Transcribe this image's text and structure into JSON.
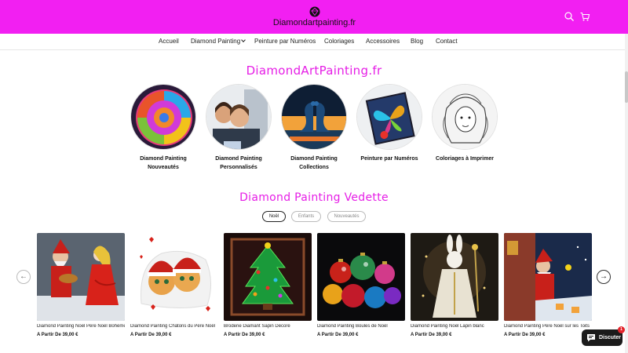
{
  "header": {
    "brand_name": "Diamondartpainting.fr",
    "logo_icon": "diamond-logo-icon",
    "search_icon": "search-icon",
    "cart_icon": "cart-icon",
    "bg_color": "#f21ff2"
  },
  "nav": {
    "items": [
      {
        "label": "Accueil"
      },
      {
        "label": "Diamond Painting"
      },
      {
        "label": "Peinture par Numéros"
      },
      {
        "label": "Coloriages"
      },
      {
        "label": "Accessoires"
      },
      {
        "label": "Blog"
      },
      {
        "label": "Contact"
      }
    ]
  },
  "hero": {
    "title": "DiamondArtPainting.fr",
    "accent_color": "#e61ee6"
  },
  "categories": [
    {
      "label_line1": "Diamond Painting",
      "label_line2": "Nouveautés"
    },
    {
      "label_line1": "Diamond Painting",
      "label_line2": "Personnalisés"
    },
    {
      "label_line1": "Diamond Painting Collections",
      "label_line2": ""
    },
    {
      "label_line1": "Peinture par Numéros",
      "label_line2": ""
    },
    {
      "label_line1": "Coloriages à Imprimer",
      "label_line2": ""
    }
  ],
  "featured": {
    "title": "Diamond Painting Vedette",
    "tabs": [
      {
        "label": "Noël",
        "active": true
      },
      {
        "label": "Enfants",
        "active": false
      },
      {
        "label": "Nouveautés",
        "active": false
      }
    ],
    "prev_icon": "arrow-left-icon",
    "next_icon": "arrow-right-icon",
    "products": [
      {
        "name": "Diamond Painting Noël Père Noël Bohème",
        "price": "A Partir De 39,00 €"
      },
      {
        "name": "Diamond Painting Châtons du Père Noël",
        "price": "A Partir De 39,00 €"
      },
      {
        "name": "Broderie Diamant Sapin Décoré",
        "price": "A Partir De 39,00 €"
      },
      {
        "name": "Diamond Painting Boules de Noël",
        "price": "A Partir De 39,00 €"
      },
      {
        "name": "Diamond Painting Noël Lapin blanc",
        "price": "A Partir De 39,00 €"
      },
      {
        "name": "Diamond Painting Père Noël sur les Toits",
        "price": "A Partir De 39,00 €"
      }
    ]
  },
  "chat": {
    "label": "Discuter",
    "badge": "1",
    "icon": "chat-bubble-icon"
  }
}
